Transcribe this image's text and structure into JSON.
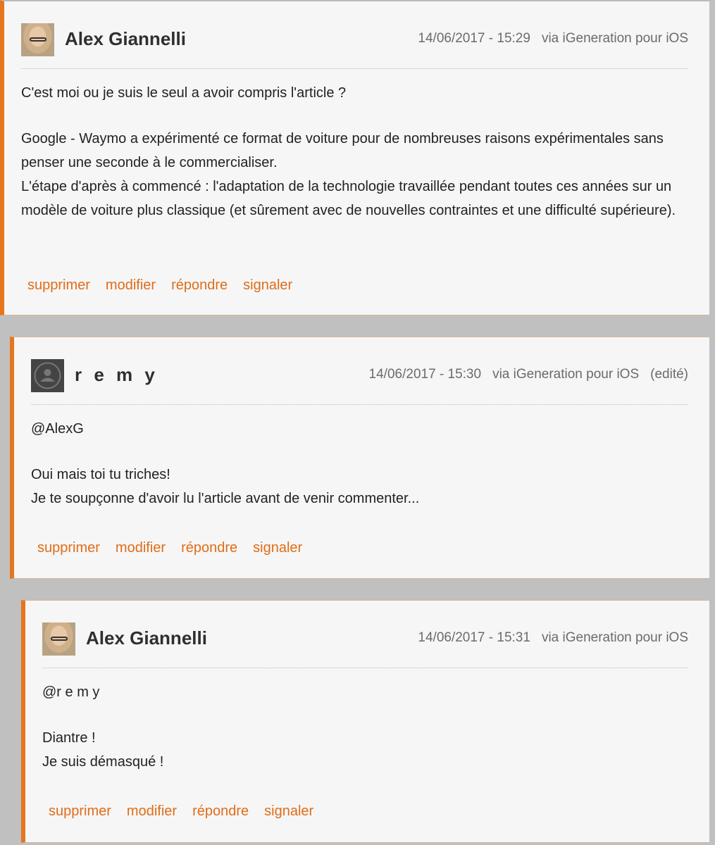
{
  "comments": [
    {
      "author": "Alex Giannelli",
      "date": "14/06/2017 - 15:29",
      "via": "via iGeneration pour iOS",
      "lines": [
        "C'est moi ou je suis le seul a avoir compris l'article ?",
        "",
        "Google - Waymo a expérimenté ce format de voiture pour de nombreuses raisons expérimentales sans penser une seconde à le commercialiser.",
        "L'étape d'après à commencé : l'adaptation de la technologie travaillée pendant toutes ces années sur un modèle de voiture plus classique (et sûrement avec de nouvelles contraintes et une difficulté supérieure)."
      ]
    },
    {
      "author": "r e m y",
      "date": "14/06/2017 - 15:30",
      "via": "via iGeneration pour iOS",
      "edited": "(edité)",
      "lines": [
        "@AlexG",
        "",
        "Oui mais toi tu triches!",
        "Je te soupçonne d'avoir lu l'article avant de venir commenter..."
      ]
    },
    {
      "author": "Alex Giannelli",
      "date": "14/06/2017 - 15:31",
      "via": "via iGeneration pour iOS",
      "lines": [
        "@r e m y",
        "",
        "Diantre !",
        "Je suis démasqué !"
      ]
    }
  ],
  "actions": {
    "delete": "supprimer",
    "edit": "modifier",
    "reply": "répondre",
    "report": "signaler"
  },
  "colors": {
    "accent": "#e5761e",
    "link": "#e06d18",
    "background": "#c0c0c0",
    "card": "#f6f6f6"
  }
}
